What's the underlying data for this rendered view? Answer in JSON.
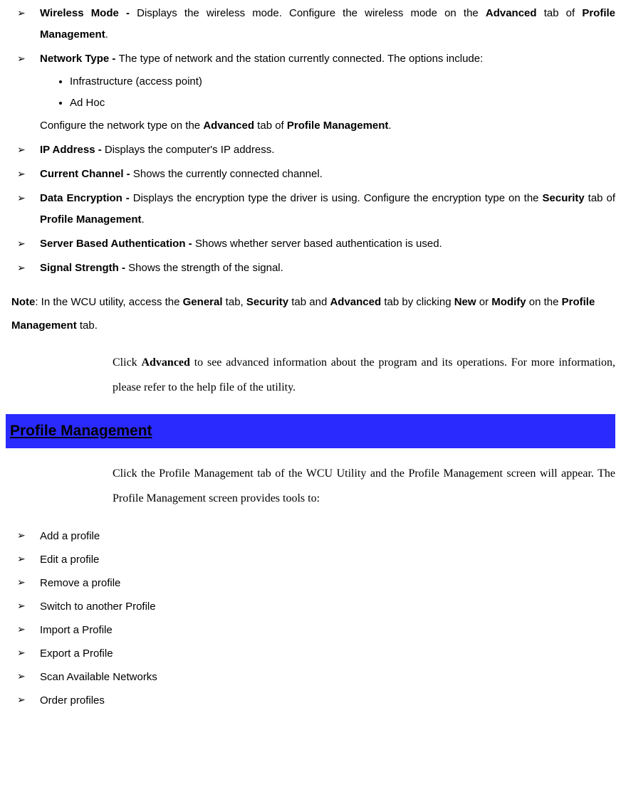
{
  "items": [
    {
      "term": "Wireless Mode - ",
      "desc_pre": "Displays the wireless mode. Configure the wireless mode on the ",
      "bold1": "Advanced",
      "mid1": " tab of ",
      "bold2": "Profile Management",
      "tail": "."
    },
    {
      "term": "Network Type - ",
      "desc_pre": "The type of network and the station currently connected. The options include:",
      "sub": [
        "Infrastructure (access point)",
        "Ad Hoc"
      ],
      "sub_note_pre": "Configure the network type on the ",
      "sub_note_b1": "Advanced",
      "sub_note_mid": " tab of ",
      "sub_note_b2": "Profile Management",
      "sub_note_tail": "."
    },
    {
      "term": "IP Address - ",
      "desc_pre": "Displays the computer's IP address."
    },
    {
      "term": "Current Channel - ",
      "desc_pre": "Shows the currently connected channel."
    },
    {
      "term": "Data Encryption - ",
      "desc_pre": "Displays the encryption type the driver is using. Configure the encryption type on the ",
      "bold1": "Security",
      "mid1": " tab of ",
      "bold2": "Profile Management",
      "tail": "."
    },
    {
      "term": "Server Based Authentication - ",
      "desc_pre": "Shows whether server based authentication is used."
    },
    {
      "term": "Signal Strength - ",
      "desc_pre": "Shows the strength of the signal."
    }
  ],
  "note": {
    "label": "Note",
    "pre": ": In the WCU utility, access the ",
    "b1": "General",
    "mid1": " tab, ",
    "b2": "Security",
    "mid2": " tab and ",
    "b3": "Advanced",
    "mid3": " tab by clicking ",
    "b4": "New",
    "mid4": " or ",
    "b5": "Modify",
    "mid5": " on the ",
    "b6": "Profile Management",
    "tail": " tab."
  },
  "serif1": {
    "pre": "Click ",
    "b1": "Advanced",
    "rest": " to see advanced information about the program and its operations. For more information, please refer to the help file of the utility."
  },
  "section_title": "Profile Management",
  "serif2": "Click the Profile Management tab of the WCU Utility and the Profile Management screen will appear. The Profile Management screen provides tools to:",
  "tools": [
    "Add a profile",
    "Edit a profile",
    "Remove a profile",
    "Switch to another Profile",
    "Import a Profile",
    "Export a Profile",
    "Scan Available Networks",
    "Order profiles"
  ]
}
